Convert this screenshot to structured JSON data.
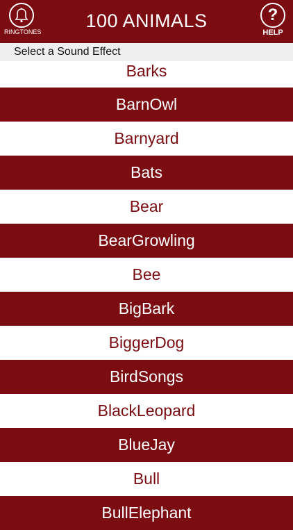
{
  "header": {
    "title": "100 ANIMALS",
    "ringtones_label": "RINGTONES",
    "help_label": "HELP",
    "help_glyph": "?"
  },
  "subheader": "Select a Sound Effect",
  "items": [
    "Barks",
    "BarnOwl",
    "Barnyard",
    "Bats",
    "Bear",
    "BearGrowling",
    "Bee",
    "BigBark",
    "BiggerDog",
    "BirdSongs",
    "BlackLeopard",
    "BlueJay",
    "Bull",
    "BullElephant"
  ],
  "colors": {
    "accent": "#7a0c12",
    "background": "#ffffff",
    "subheader_bg": "#efefef"
  }
}
